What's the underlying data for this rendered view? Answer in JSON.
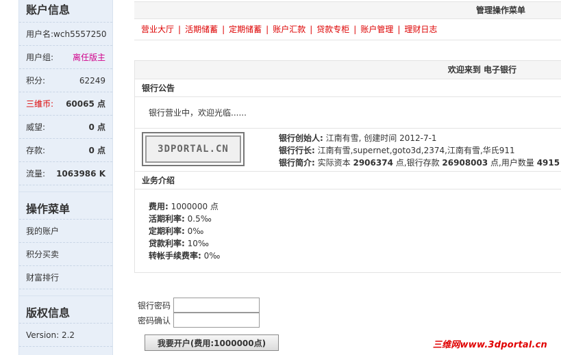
{
  "sidebar": {
    "account_title": "账户信息",
    "fields": [
      {
        "label": "用户名:",
        "value": "wch5557250"
      },
      {
        "label": "用户组:",
        "value": "离任版主"
      },
      {
        "label": "积分:",
        "value": "62249"
      },
      {
        "label": "三维币:",
        "value": "60065 点"
      },
      {
        "label": "威望:",
        "value": "0 点"
      },
      {
        "label": "存款:",
        "value": "0 点"
      },
      {
        "label": "流量:",
        "value": "1063986 K"
      }
    ],
    "menu_title": "操作菜单",
    "menu_items": [
      "我的账户",
      "积分买卖",
      "财富排行"
    ],
    "copyright_title": "版权信息",
    "version": "Version: 2.2"
  },
  "main": {
    "admin_menu_title": "管理操作菜单",
    "nav_links": [
      "营业大厅",
      "活期储蓄",
      "定期储蓄",
      "账户汇款",
      "贷款专柜",
      "账户管理",
      "理财日志"
    ],
    "welcome": "欢迎来到 电子银行",
    "notice_title": "银行公告",
    "notice_text": "银行营业中，欢迎光临......",
    "logo_text": "3DPORTAL.CN",
    "founder_label": "银行创始人:",
    "founder_value": "江南有雪, 创建时间 2012-7-1",
    "president_label": "银行行长:",
    "president_value": "江南有雪,supernet,goto3d,2374,江南有雪,华氏911",
    "intro_label": "银行简介:",
    "intro_prefix": "实际资本",
    "capital": "2906374",
    "intro_mid1": "点,银行存款",
    "deposits": "26908003",
    "intro_mid2": "点,用户数量",
    "users": "4915",
    "biz_title": "业务介绍",
    "biz_items": [
      {
        "label": "费用:",
        "value": "1000000 点"
      },
      {
        "label": "活期利率:",
        "value": "0.5‰"
      },
      {
        "label": "定期利率:",
        "value": "0‰"
      },
      {
        "label": "贷款利率:",
        "value": "10‰"
      },
      {
        "label": "转帐手续费率:",
        "value": "0‰"
      }
    ]
  },
  "form": {
    "password_label": "银行密码",
    "confirm_label": "密码确认",
    "password_value": "",
    "confirm_value": "",
    "submit_label": "我要开户(费用:1000000点)"
  },
  "watermark": "三维网www.3dportal.cn",
  "colors": {
    "link_red": "#dd0000",
    "sidebar_bg": "#e8eff8",
    "group_pink": "#d0008a"
  }
}
